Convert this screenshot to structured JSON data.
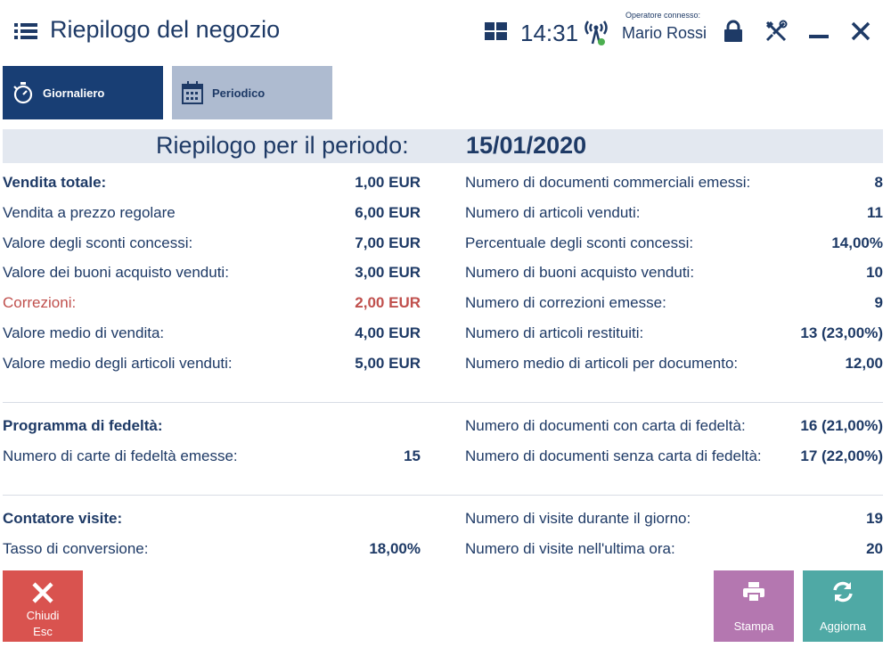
{
  "header": {
    "title": "Riepilogo del negozio",
    "clock": "14:31",
    "operator_caption": "Operatore connesso:",
    "operator_name": "Mario Rossi"
  },
  "tabs": [
    {
      "label": "Giornaliero",
      "active": true
    },
    {
      "label": "Periodico",
      "active": false
    }
  ],
  "period": {
    "label": "Riepilogo per il periodo:",
    "value": "15/01/2020"
  },
  "sales": {
    "left": [
      {
        "label": "Vendita totale:",
        "value": "1,00 EUR"
      },
      {
        "label": "Vendita a prezzo regolare",
        "value": "6,00 EUR"
      },
      {
        "label": "Valore degli sconti concessi:",
        "value": "7,00 EUR"
      },
      {
        "label": "Valore dei buoni acquisto venduti:",
        "value": "3,00 EUR"
      },
      {
        "label": "Correzioni:",
        "value": "2,00 EUR"
      },
      {
        "label": "Valore medio di vendita:",
        "value": "4,00 EUR"
      },
      {
        "label": "Valore medio degli articoli venduti:",
        "value": "5,00 EUR"
      }
    ],
    "right": [
      {
        "label": "Numero di documenti commerciali emessi:",
        "value": "8"
      },
      {
        "label": "Numero di articoli venduti:",
        "value": "11"
      },
      {
        "label": "Percentuale degli sconti concessi:",
        "value": "14,00%"
      },
      {
        "label": "Numero di buoni acquisto venduti:",
        "value": "10"
      },
      {
        "label": "Numero di correzioni emesse:",
        "value": "9"
      },
      {
        "label": "Numero di articoli restituiti:",
        "value": "13 (23,00%)"
      },
      {
        "label": "Numero medio di articoli per documento:",
        "value": "12,00"
      }
    ]
  },
  "loyalty": {
    "heading": "Programma di fedeltà:",
    "cards_label": "Numero di carte di fedeltà emesse:",
    "cards_value": "15",
    "right": [
      {
        "label": "Numero di documenti con carta di fedeltà:",
        "value": "16 (21,00%)"
      },
      {
        "label": "Numero di documenti senza carta di fedeltà:",
        "value": "17 (22,00%)"
      }
    ]
  },
  "visits": {
    "heading": "Contatore visite:",
    "conversion_label": "Tasso di conversione:",
    "conversion_value": "18,00%",
    "right": [
      {
        "label": "Numero di visite durante il giorno:",
        "value": "19"
      },
      {
        "label": "Numero di visite nell'ultima ora:",
        "value": "20"
      }
    ]
  },
  "buttons": {
    "close_label": "Chiudi",
    "close_shortcut": "Esc",
    "print_label": "Stampa",
    "refresh_label": "Aggiorna"
  },
  "colors": {
    "primary": "#1e3a66",
    "active_tab": "#183e74",
    "inactive_tab": "#aebbd0",
    "correction": "#c0504d",
    "close_button": "#d9534f",
    "print_button": "#b477b0",
    "refresh_button": "#4fa9a5"
  },
  "icons": {
    "menu": "menu-icon",
    "grid": "grid-icon",
    "antenna": "antenna-icon",
    "lock": "lock-icon",
    "tools": "tools-icon",
    "minimize": "minimize-icon",
    "close": "close-icon",
    "daily_tab": "stopwatch-icon",
    "periodic_tab": "calendar-icon",
    "print": "printer-icon",
    "refresh": "refresh-icon"
  }
}
